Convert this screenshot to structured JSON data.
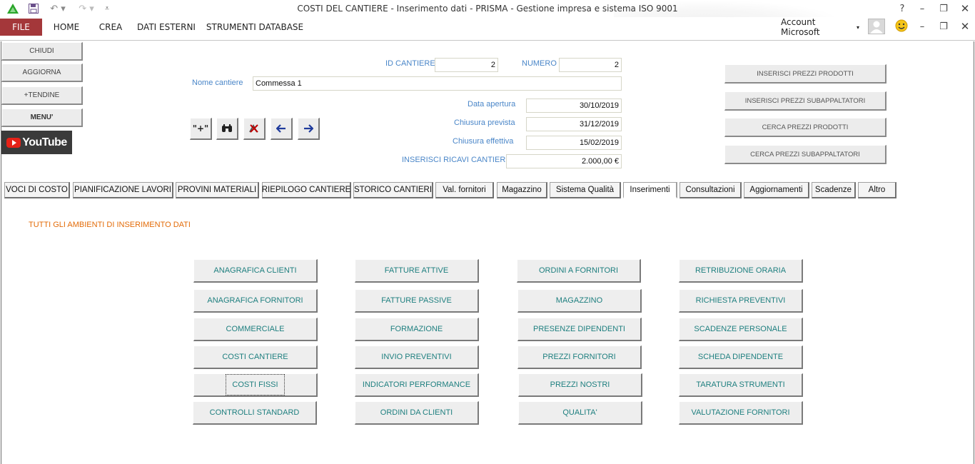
{
  "window": {
    "title": "COSTI DEL CANTIERE - Inserimento dati - PRISMA - Gestione impresa e sistema ISO 9001",
    "account": "Account Microsoft",
    "help_symbol": "?"
  },
  "ribbon": {
    "tabs": [
      "FILE",
      "HOME",
      "CREA",
      "DATI ESTERNI",
      "STRUMENTI DATABASE"
    ]
  },
  "sidebar": {
    "buttons": [
      "CHIUDI",
      "AGGIORNA",
      "+TENDINE",
      "MENU'"
    ],
    "youtube_label": "YouTube"
  },
  "header_form": {
    "id_cantiere_label": "ID CANTIERE",
    "id_cantiere_value": "2",
    "numero_label": "NUMERO",
    "numero_value": "2",
    "nome_cantiere_label": "Nome cantiere",
    "nome_cantiere_value": "Commessa 1",
    "data_apertura_label": "Data apertura",
    "data_apertura_value": "30/10/2019",
    "chiusura_prevista_label": "Chiusura prevista",
    "chiusura_prevista_value": "31/12/2019",
    "chiusura_effettiva_label": "Chiusura effettiva",
    "chiusura_effettiva_value": "15/02/2019",
    "ricavi_label": "INSERISCI RICAVI CANTIERE",
    "ricavi_value": "2.000,00 €"
  },
  "nav_buttons": {
    "new_label": "\"+\"",
    "find_icon": "binoculars-icon",
    "delete_icon": "delete-record-icon",
    "prev_icon": "arrow-left-icon",
    "next_icon": "arrow-right-icon"
  },
  "right_buttons": [
    "INSERISCI PREZZI PRODOTTI",
    "INSERISCI PREZZI SUBAPPALTATORI",
    "CERCA PREZZI PRODOTTI",
    "CERCA PREZZI SUBAPPALTATORI"
  ],
  "form_tabs": {
    "items": [
      "VOCI DI COSTO",
      "PIANIFICAZIONE LAVORI",
      "PROVINI MATERIALI",
      "RIEPILOGO CANTIERE",
      "STORICO CANTIERI",
      "Val. fornitori",
      "Magazzino",
      "Sistema Qualità",
      "Inserimenti",
      "Consultazioni",
      "Aggiornamenti",
      "Scadenze",
      "Altro"
    ],
    "active": "Inserimenti"
  },
  "section_title": "TUTTI GLI AMBIENTI DI INSERIMENTO DATI",
  "grid": {
    "col1": [
      "ANAGRAFICA CLIENTI",
      "ANAGRAFICA FORNITORI",
      "COMMERCIALE",
      "COSTI CANTIERE",
      "COSTI FISSI",
      "CONTROLLI STANDARD"
    ],
    "col2": [
      "FATTURE ATTIVE",
      "FATTURE PASSIVE",
      "FORMAZIONE",
      "INVIO PREVENTIVI",
      "INDICATORI PERFORMANCE",
      "ORDINI DA CLIENTI"
    ],
    "col3": [
      "ORDINI A FORNITORI",
      "MAGAZZINO",
      "PRESENZE DIPENDENTI",
      "PREZZI FORNITORI",
      "PREZZI NOSTRI",
      "QUALITA'"
    ],
    "col4": [
      "RETRIBUZIONE ORARIA",
      "RICHIESTA PREVENTIVI",
      "SCADENZE PERSONALE",
      "SCHEDA DIPENDENTE",
      "TARATURA STRUMENTI",
      "VALUTAZIONE FORNITORI"
    ]
  }
}
